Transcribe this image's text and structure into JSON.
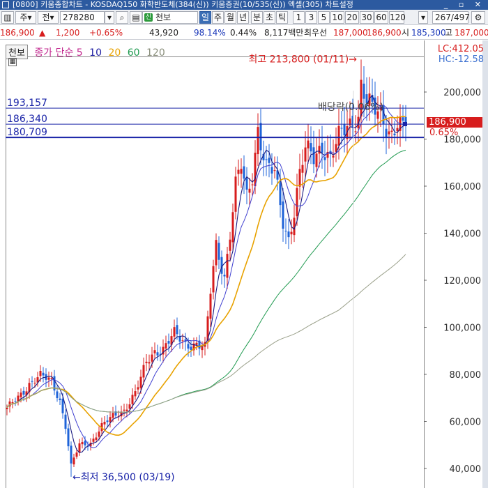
{
  "window": {
    "title": "[0800] 키움종합차트 - KOSDAQ150 화학반도체(384(신)) 키움증권(10/535(신)) 엑셀(305) 차트설정",
    "controls": "_ ▫ ✕"
  },
  "toolbar": {
    "period_label": "주",
    "market_label": "전",
    "code_value": "278280",
    "stock_name": "천보",
    "periods": [
      "일",
      "주",
      "월",
      "년",
      "분",
      "초",
      "틱"
    ],
    "intervals": [
      "1",
      "3",
      "5",
      "10",
      "20",
      "30",
      "60",
      "120"
    ],
    "count_value": "267",
    "count_total": "/497"
  },
  "quote": {
    "price": "186,900",
    "change": "1,200",
    "change_pct": "+0.65%",
    "volume": "43,920",
    "vol_ratio": "98.14%",
    "turnover": "0.44%",
    "trade_value": "8,117백만",
    "pref_label": "최우선",
    "ask": "187,000",
    "bid": "186,900",
    "open_label": "시",
    "open": "185,300",
    "high_label": "고",
    "high": "187,000"
  },
  "legend": {
    "name": "천보",
    "ma_label": "종가 단순 5",
    "ma10": "10",
    "ma20": "20",
    "ma60": "60",
    "ma120": "120"
  },
  "side": {
    "lc": "LC:412.05",
    "hc": "HC:-12.58",
    "current_price": "186,900",
    "current_pct": "0.65%"
  },
  "colors": {
    "up": "#d71d1d",
    "down": "#1e63d8",
    "ma5": "#1a1a80",
    "ma10": "#4040d0",
    "ma20": "#e8a200",
    "ma60": "#209a50",
    "ma120": "#9aa08a"
  },
  "chart_data": {
    "type": "candlestick",
    "ylim": [
      33000,
      232000
    ],
    "yticks": [
      40000,
      60000,
      80000,
      100000,
      120000,
      140000,
      160000,
      180000,
      200000
    ],
    "ytick_labels": [
      "40,000",
      "60,000",
      "80,000",
      "100,000",
      "120,000",
      "140,000",
      "160,000",
      "180,000",
      "200,000"
    ],
    "bar_count": 150,
    "hlines": [
      {
        "value": 193157,
        "label": "193,157",
        "width": 1
      },
      {
        "value": 186340,
        "label": "186,340",
        "width": 1
      },
      {
        "value": 180709,
        "label": "180,709",
        "width": 2
      }
    ],
    "annotations": {
      "high": {
        "label": "최고 213,800 (01/11)",
        "value": 213800,
        "bar": 127
      },
      "low": {
        "label": "최저 36,500 (03/19)",
        "value": 36500,
        "bar": 23
      },
      "dividend": {
        "label": "배당락(0.06%)"
      }
    },
    "anchors": [
      [
        0,
        65000
      ],
      [
        8,
        76000
      ],
      [
        12,
        79000
      ],
      [
        16,
        77500
      ],
      [
        19,
        69000
      ],
      [
        21,
        58000
      ],
      [
        23,
        41000
      ],
      [
        26,
        50000
      ],
      [
        30,
        51000
      ],
      [
        34,
        58000
      ],
      [
        38,
        62000
      ],
      [
        42,
        65000
      ],
      [
        46,
        72000
      ],
      [
        48,
        78000
      ],
      [
        50,
        85000
      ],
      [
        53,
        90000
      ],
      [
        56,
        91000
      ],
      [
        60,
        97000
      ],
      [
        64,
        93000
      ],
      [
        68,
        93000
      ],
      [
        71,
        91000
      ],
      [
        73,
        115000
      ],
      [
        75,
        135000
      ],
      [
        78,
        122000
      ],
      [
        80,
        140000
      ],
      [
        82,
        160000
      ],
      [
        84,
        168000
      ],
      [
        86,
        155000
      ],
      [
        88,
        165000
      ],
      [
        90,
        185000
      ],
      [
        93,
        168000
      ],
      [
        96,
        165000
      ],
      [
        99,
        145000
      ],
      [
        101,
        138000
      ],
      [
        103,
        150000
      ],
      [
        105,
        165000
      ],
      [
        107,
        175000
      ],
      [
        110,
        172000
      ],
      [
        113,
        178000
      ],
      [
        116,
        172000
      ],
      [
        119,
        180000
      ],
      [
        122,
        185000
      ],
      [
        124,
        188000
      ],
      [
        126,
        190000
      ],
      [
        127,
        204000
      ],
      [
        129,
        196000
      ],
      [
        131,
        192000
      ],
      [
        134,
        190000
      ],
      [
        136,
        186000
      ],
      [
        138,
        183000
      ],
      [
        140,
        187000
      ],
      [
        142,
        184000
      ],
      [
        143,
        186900
      ]
    ]
  }
}
